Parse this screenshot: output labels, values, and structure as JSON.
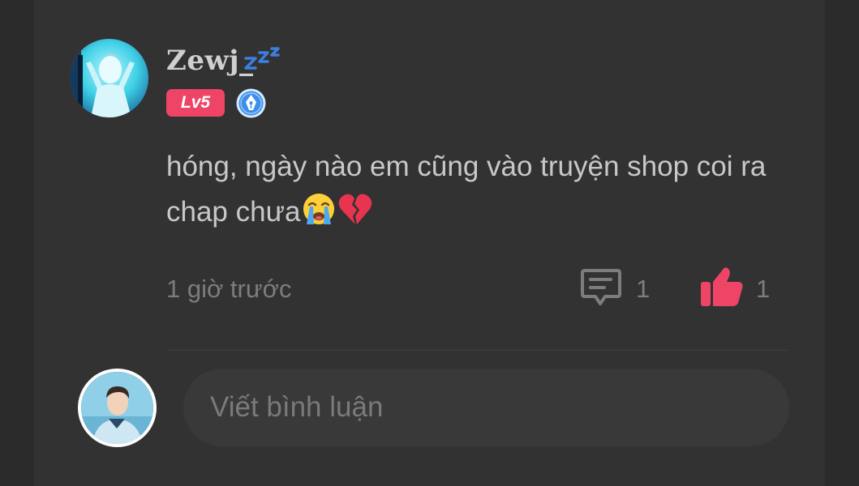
{
  "comment": {
    "author": {
      "username": "Zewj_",
      "status_icon": "zzz-sleeping-icon",
      "level": "Lv5",
      "rank_icon": "pen-nib-badge-icon",
      "avatar_icon": "anime-character-avatar"
    },
    "text": "hóng, ngày nào em cũng vào truyện shop coi ra chap chưa",
    "text_emojis": [
      "crying-face-emoji",
      "broken-heart-emoji"
    ],
    "timestamp": "1 giờ trước",
    "reply_count": "1",
    "like_count": "1",
    "reply_icon": "comment-bubble-icon",
    "like_icon": "thumbs-up-icon"
  },
  "composer": {
    "placeholder": "Viết bình luận",
    "avatar_icon": "current-user-avatar"
  },
  "colors": {
    "background": "#2b2b2b",
    "panel": "#323232",
    "level_badge": "#ee4566",
    "like_active": "#ee4566",
    "rank_badge": "#3d8fe8",
    "muted_text": "#7d7d7d",
    "body_text": "#c8c8c8"
  }
}
